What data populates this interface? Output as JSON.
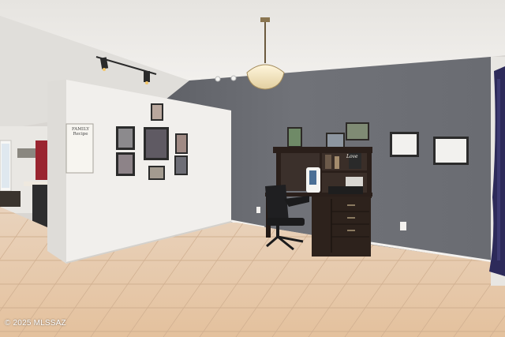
{
  "watermark": "© 2025 MLSSAZ",
  "family_sign": "FAMILY Recipe",
  "desk_sign": "Love",
  "colors": {
    "ceiling": "#eceae7",
    "accent_wall": "#6e7076",
    "white_wall": "#f1efec",
    "floor_tile": "#e7c9ab",
    "desk": "#2a1f1a",
    "curtain_right": "#2d2a5a",
    "curtain_left": "#9a2530"
  }
}
